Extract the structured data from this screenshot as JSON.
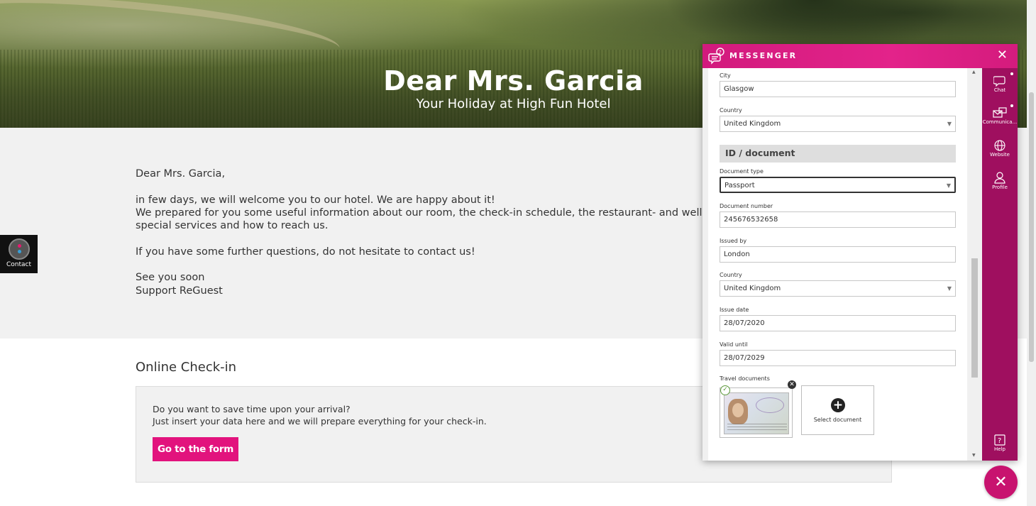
{
  "hero": {
    "title": "Dear Mrs. Garcia",
    "subtitle": "Your Holiday at High Fun Hotel"
  },
  "letter": {
    "greeting": "Dear Mrs. Garcia,",
    "line1": "in few days, we will welcome you to our hotel. We are happy about it!",
    "line2": "We prepared for you some useful information about our room, the check-in schedule, the restaurant- and wellness center opening",
    "line3": "special services and how to reach us.",
    "questions": "If you have some further questions, do not hesitate to contact us!",
    "closing1": "See you soon",
    "closing2": "Support ReGuest"
  },
  "contact_tab": {
    "label": "Contact"
  },
  "checkin": {
    "title": "Online Check-in",
    "text1": "Do you want to save time upon your arrival?",
    "text2": "Just insert your data here and we will prepare everything for your check-in.",
    "button": "Go to the form"
  },
  "messenger": {
    "title": "MESSENGER",
    "close": "✕",
    "fields": {
      "city_label": "City",
      "city_value": "Glasgow",
      "country_label": "Country",
      "country_value": "United Kingdom",
      "section_title": "ID / document",
      "doc_type_label": "Document type",
      "doc_type_value": "Passport",
      "doc_number_label": "Document number",
      "doc_number_value": "245676532658",
      "issued_by_label": "Issued by",
      "issued_by_value": "London",
      "doc_country_label": "Country",
      "doc_country_value": "United Kingdom",
      "issue_date_label": "Issue date",
      "issue_date_value": "28/07/2020",
      "valid_until_label": "Valid until",
      "valid_until_value": "28/07/2029",
      "travel_docs_label": "Travel documents",
      "select_document": "Select document"
    },
    "sidebar": [
      {
        "label": "Chat",
        "icon": "chat-icon"
      },
      {
        "label": "Communica...",
        "icon": "communication-icon"
      },
      {
        "label": "Website",
        "icon": "globe-icon"
      },
      {
        "label": "Profile",
        "icon": "profile-icon"
      },
      {
        "label": "Help",
        "icon": "help-icon"
      }
    ]
  },
  "fab": {
    "close": "✕"
  },
  "colors": {
    "brand_pink": "#e2137d",
    "sidebar_purple": "#9f0f5f"
  }
}
